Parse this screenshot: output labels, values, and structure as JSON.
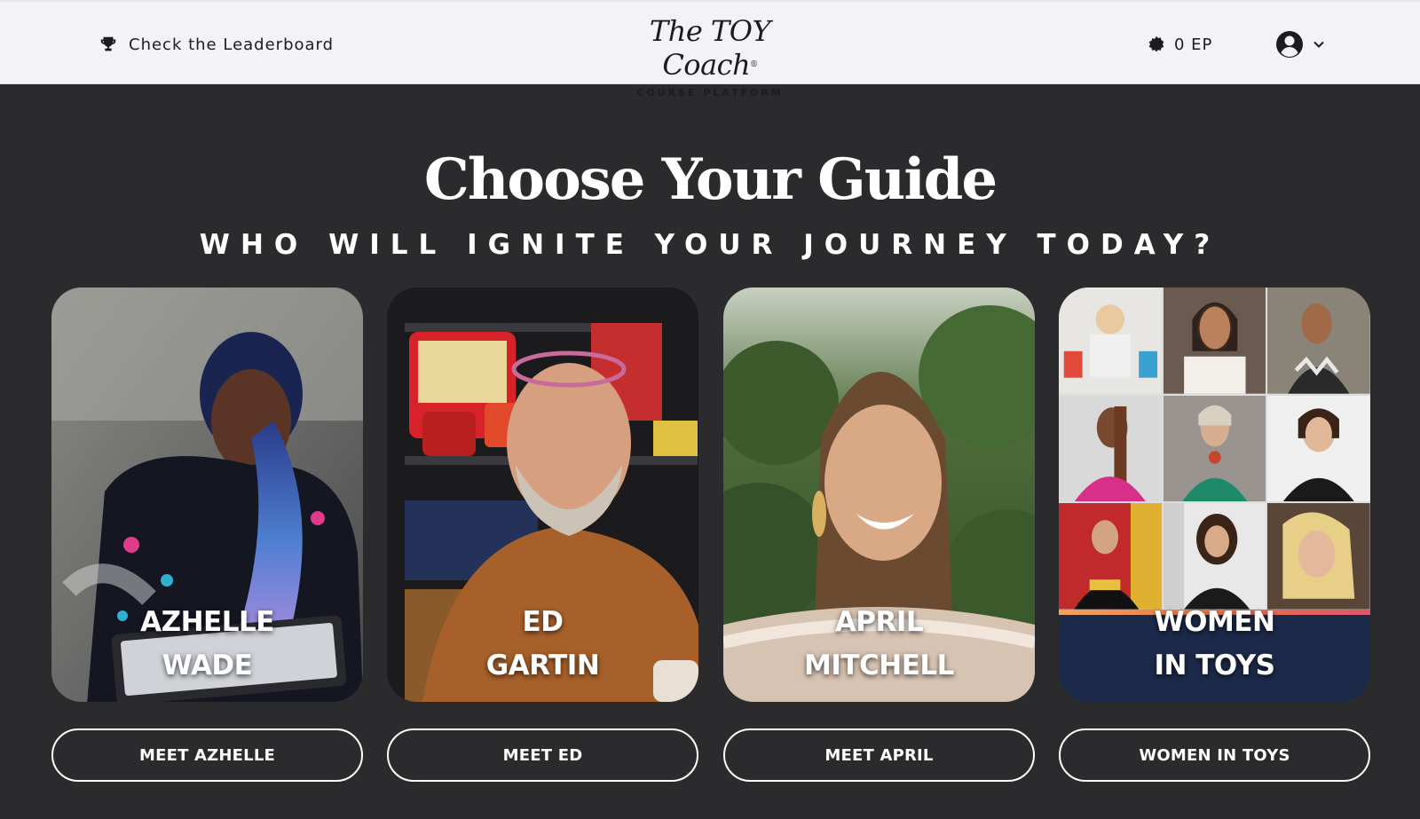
{
  "header": {
    "leaderboard_label": "Check the Leaderboard",
    "logo_script": "The TOY Coach",
    "logo_subtitle": "COURSE PLATFORM",
    "ep_label": "0 EP"
  },
  "hero": {
    "title": "Choose Your Guide",
    "subtitle": "WHO WILL IGNITE YOUR JOURNEY TODAY?"
  },
  "guides": [
    {
      "name_line1": "AZHELLE",
      "name_line2": "WADE",
      "button": "MEET AZHELLE"
    },
    {
      "name_line1": "ED",
      "name_line2": "GARTIN",
      "button": "MEET ED"
    },
    {
      "name_line1": "APRIL",
      "name_line2": "MITCHELL",
      "button": "MEET APRIL"
    },
    {
      "name_line1": "WOMEN",
      "name_line2": "IN TOYS",
      "button": "WOMEN IN TOYS"
    }
  ],
  "icons": {
    "leaderboard": "trophy-icon",
    "ep": "badge-icon",
    "user": "user-circle-icon",
    "menu": "chevron-down-icon"
  },
  "colors": {
    "header_bg": "#f3f3f5",
    "page_bg": "#2b2b2d",
    "women_card_bg": "#1c2a4a"
  }
}
